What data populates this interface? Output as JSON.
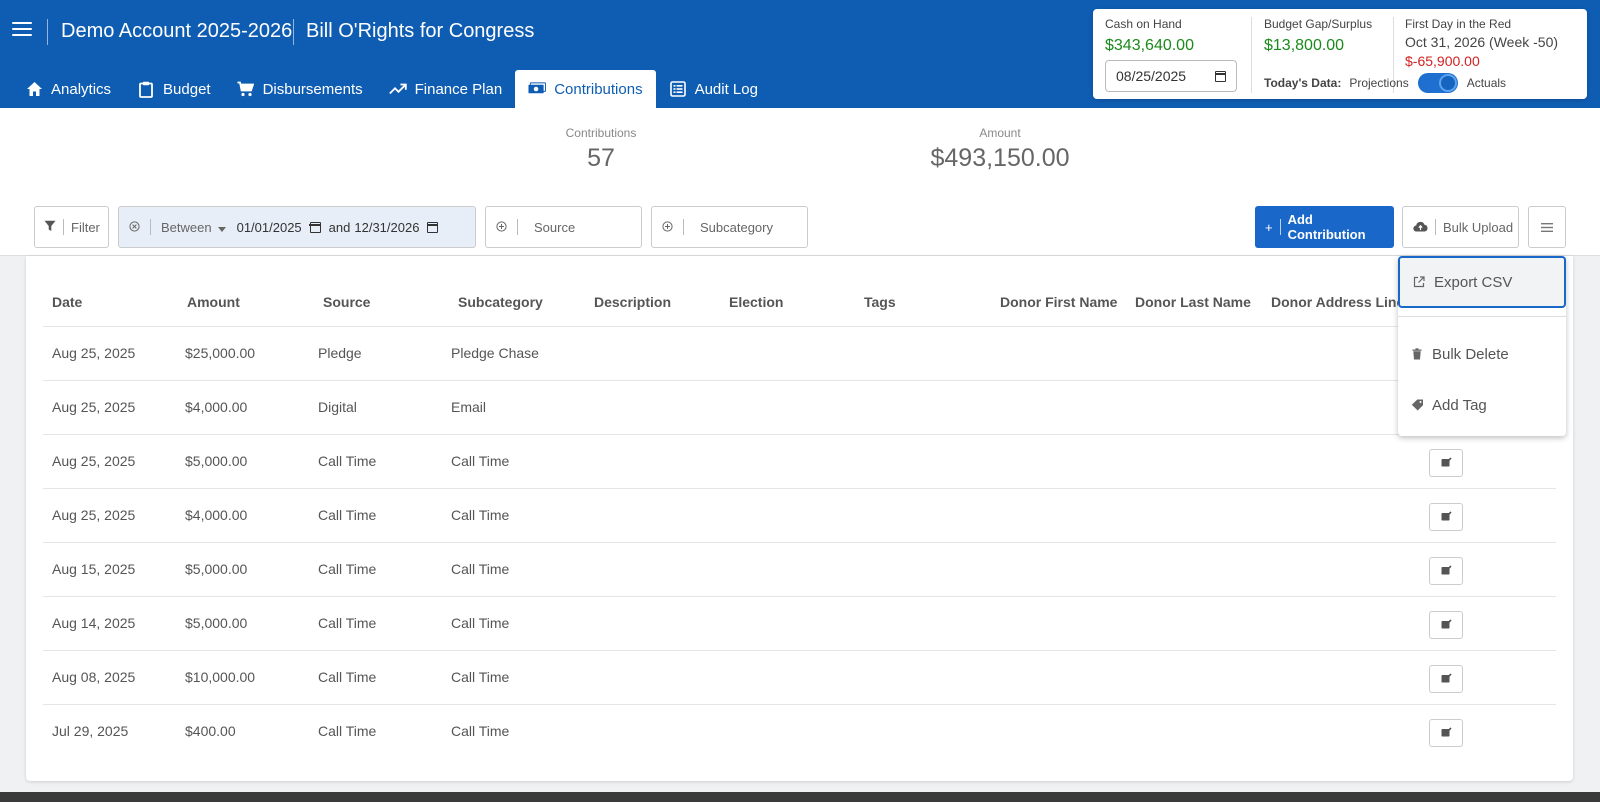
{
  "header": {
    "account": "Demo Account 2025-2026",
    "campaign": "Bill O'Rights for Congress"
  },
  "tabs": [
    {
      "label": "Analytics",
      "icon": "home-icon"
    },
    {
      "label": "Budget",
      "icon": "clipboard-icon"
    },
    {
      "label": "Disbursements",
      "icon": "cart-icon"
    },
    {
      "label": "Finance Plan",
      "icon": "trending-up-icon"
    },
    {
      "label": "Contributions",
      "icon": "money-icon",
      "active": true
    },
    {
      "label": "Audit Log",
      "icon": "list-icon"
    }
  ],
  "summary": {
    "cash_label": "Cash on Hand",
    "cash_value": "$343,640.00",
    "date_value": "08/25/2025",
    "gap_label": "Budget Gap/Surplus",
    "gap_value": "$13,800.00",
    "red_label": "First Day in the Red",
    "red_date": "Oct 31, 2026 (Week -50)",
    "red_value": "$-65,900.00",
    "today_label": "Today's Data:",
    "projections": "Projections",
    "actuals": "Actuals"
  },
  "stats": {
    "contributions_label": "Contributions",
    "contributions_value": "57",
    "amount_label": "Amount",
    "amount_value": "$493,150.00"
  },
  "filters": {
    "filter_label": "Filter",
    "between_label": "Between",
    "start_date": "01/01/2025",
    "and_label": "and",
    "end_date": "12/31/2026",
    "source_label": "Source",
    "subcategory_label": "Subcategory"
  },
  "actions": {
    "add_label": "Add Contribution",
    "bulk_upload_label": "Bulk Upload"
  },
  "menu": {
    "export_label": "Export CSV",
    "bulk_delete_label": "Bulk Delete",
    "add_tag_label": "Add Tag"
  },
  "table": {
    "columns": [
      "Date",
      "Amount",
      "Source",
      "Subcategory",
      "Description",
      "Election",
      "Tags",
      "Donor First Name",
      "Donor Last Name",
      "Donor Address Line"
    ],
    "rows": [
      {
        "date": "Aug 25, 2025",
        "amount": "$25,000.00",
        "source": "Pledge",
        "subcategory": "Pledge Chase"
      },
      {
        "date": "Aug 25, 2025",
        "amount": "$4,000.00",
        "source": "Digital",
        "subcategory": "Email"
      },
      {
        "date": "Aug 25, 2025",
        "amount": "$5,000.00",
        "source": "Call Time",
        "subcategory": "Call Time"
      },
      {
        "date": "Aug 25, 2025",
        "amount": "$4,000.00",
        "source": "Call Time",
        "subcategory": "Call Time"
      },
      {
        "date": "Aug 15, 2025",
        "amount": "$5,000.00",
        "source": "Call Time",
        "subcategory": "Call Time"
      },
      {
        "date": "Aug 14, 2025",
        "amount": "$5,000.00",
        "source": "Call Time",
        "subcategory": "Call Time"
      },
      {
        "date": "Aug 08, 2025",
        "amount": "$10,000.00",
        "source": "Call Time",
        "subcategory": "Call Time"
      },
      {
        "date": "Jul 29, 2025",
        "amount": "$400.00",
        "source": "Call Time",
        "subcategory": "Call Time"
      }
    ]
  },
  "colors": {
    "brand": "#0f5db3",
    "positive": "#1a8a1a",
    "negative": "#d32222",
    "accent": "#1867c9"
  }
}
